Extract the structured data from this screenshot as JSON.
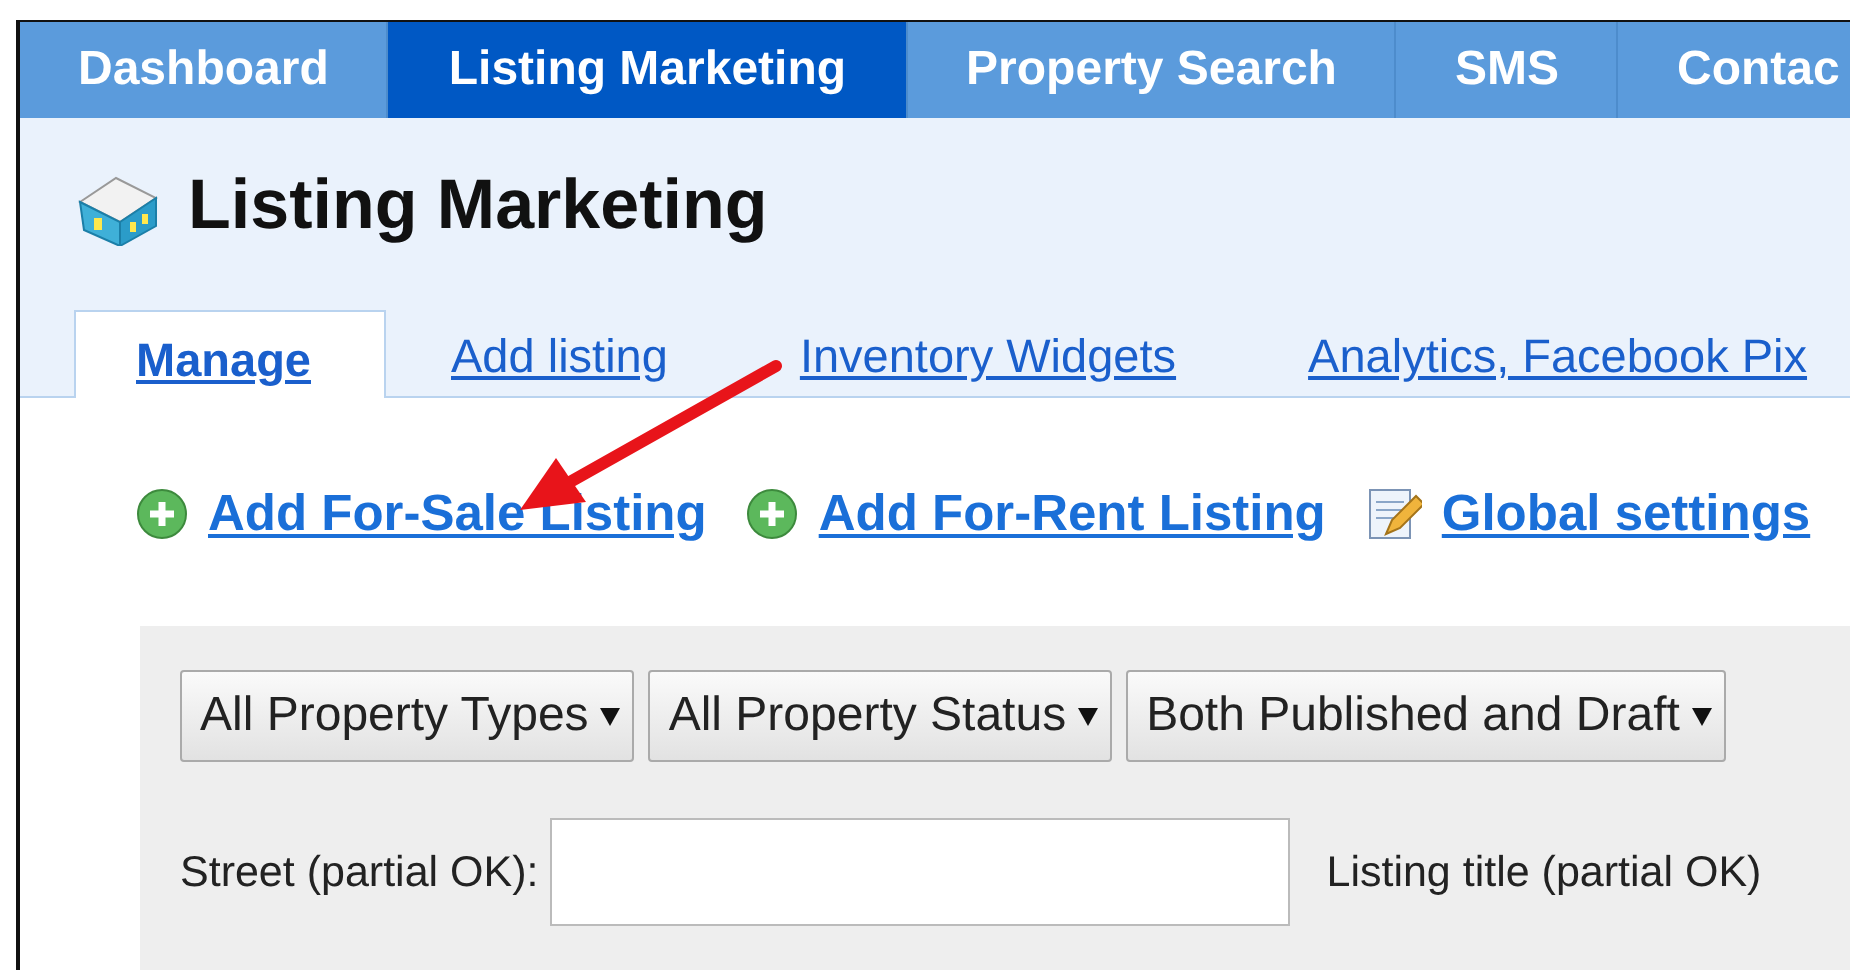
{
  "nav": [
    {
      "label": "Dashboard",
      "selected": false
    },
    {
      "label": "Listing Marketing",
      "selected": true
    },
    {
      "label": "Property Search",
      "selected": false
    },
    {
      "label": "SMS",
      "selected": false
    },
    {
      "label": "Contac",
      "selected": false
    }
  ],
  "page_title": "Listing Marketing",
  "tabs": [
    {
      "label": "Manage",
      "selected": true
    },
    {
      "label": "Add listing",
      "selected": false
    },
    {
      "label": "Inventory Widgets",
      "selected": false
    },
    {
      "label": "Analytics, Facebook Pix",
      "selected": false
    }
  ],
  "actions": [
    {
      "label": "Add For-Sale Listing",
      "kind": "add"
    },
    {
      "label": "Add For-Rent Listing",
      "kind": "add"
    },
    {
      "label": "Global settings",
      "kind": "settings"
    }
  ],
  "filters": {
    "selects": [
      {
        "value": "All Property Types"
      },
      {
        "value": "All Property Status"
      },
      {
        "value": "Both Published and Draft"
      }
    ],
    "fields": [
      {
        "label": "Street (partial OK):",
        "kind": "text"
      },
      {
        "label": "Listing title (partial OK)",
        "kind": "label"
      }
    ]
  }
}
